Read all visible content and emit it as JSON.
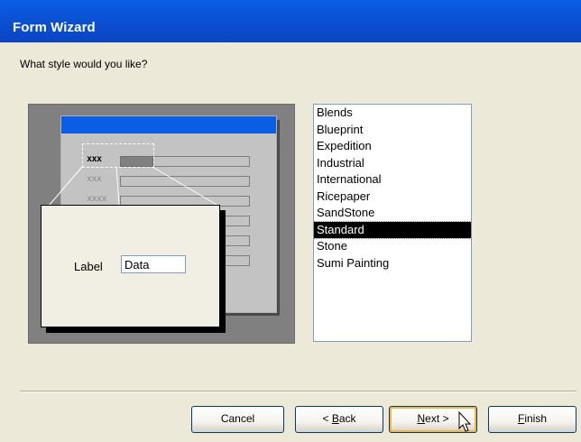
{
  "window": {
    "title": "Form Wizard"
  },
  "prompt": "What style would you like?",
  "preview": {
    "field_placeholders": [
      "xxx",
      "xxx",
      "xxxx"
    ],
    "zoom": {
      "label": "Label",
      "data": "Data"
    },
    "colors": {
      "header": "#0a5ee6",
      "background": "#808080",
      "form": "#c3c3c3"
    }
  },
  "styles": {
    "items": [
      "Blends",
      "Blueprint",
      "Expedition",
      "Industrial",
      "International",
      "Ricepaper",
      "SandStone",
      "Standard",
      "Stone",
      "Sumi Painting"
    ],
    "selected": "Standard"
  },
  "buttons": {
    "cancel": "Cancel",
    "back": {
      "prefix": "< ",
      "accel": "B",
      "rest": "ack"
    },
    "next": {
      "accel": "N",
      "rest": "ext >"
    },
    "finish": {
      "accel": "F",
      "rest": "inish"
    }
  },
  "cursor": "arrow-pointer-icon"
}
